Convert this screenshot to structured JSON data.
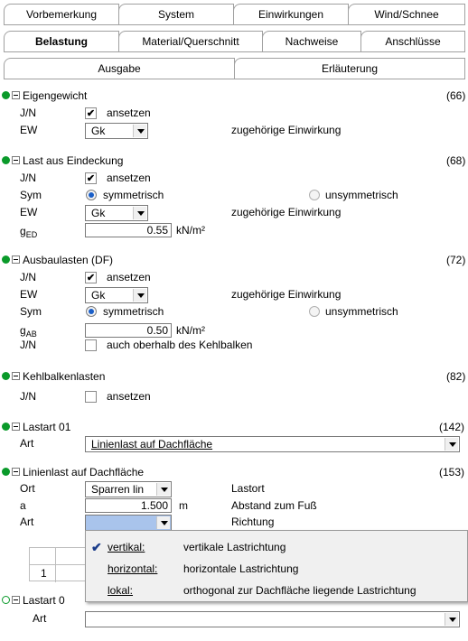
{
  "tabs": {
    "row1": [
      "Vorbemerkung",
      "System",
      "Einwirkungen",
      "Wind/Schnee"
    ],
    "row2": [
      "Belastung",
      "Material/Querschnitt",
      "Nachweise",
      "Anschlüsse"
    ],
    "row3": [
      "Ausgabe",
      "Erläuterung"
    ],
    "active": "Belastung"
  },
  "sections": {
    "eigengewicht": {
      "title": "Eigengewicht",
      "ref": "(66)",
      "jn_label": "J/N",
      "jn_text": "ansetzen",
      "ew_label": "EW",
      "ew_value": "Gk",
      "ew_hint": "zugehörige Einwirkung"
    },
    "eindeckung": {
      "title": "Last aus Eindeckung",
      "ref": "(68)",
      "jn_label": "J/N",
      "jn_text": "ansetzen",
      "sym_label": "Sym",
      "sym_opt1": "symmetrisch",
      "sym_opt2": "unsymmetrisch",
      "ew_label": "EW",
      "ew_value": "Gk",
      "ew_hint": "zugehörige Einwirkung",
      "g_label": "g",
      "g_sub": "ED",
      "g_value": "0.55",
      "g_unit": "kN/m²"
    },
    "ausbau": {
      "title": "Ausbaulasten (DF)",
      "ref": "(72)",
      "jn_label": "J/N",
      "jn_text": "ansetzen",
      "ew_label": "EW",
      "ew_value": "Gk",
      "ew_hint": "zugehörige Einwirkung",
      "sym_label": "Sym",
      "sym_opt1": "symmetrisch",
      "sym_opt2": "unsymmetrisch",
      "g_label": "g",
      "g_sub": "AB",
      "g_value": "0.50",
      "g_unit": "kN/m²",
      "jn2_label": "J/N",
      "jn2_text": "auch oberhalb des Kehlbalken"
    },
    "kehlbalken": {
      "title": "Kehlbalkenlasten",
      "ref": "(82)",
      "jn_label": "J/N",
      "jn_text": "ansetzen"
    },
    "lastart01": {
      "title": "Lastart 01",
      "ref": "(142)",
      "art_label": "Art",
      "art_value": "Linienlast auf Dachfläche"
    },
    "linienlast": {
      "title": "Linienlast auf Dachfläche",
      "ref": "(153)",
      "ort_label": "Ort",
      "ort_value": "Sparren lin",
      "ort_hint": "Lastort",
      "a_label": "a",
      "a_value": "1.500",
      "a_unit": "m",
      "a_hint": "Abstand zum Fuß",
      "art_label": "Art",
      "art_hint": "Richtung"
    },
    "lastart02": {
      "title": "Lastart 0",
      "art_label": "Art"
    }
  },
  "grid": {
    "row_label": "1"
  },
  "dropdown": {
    "items": [
      {
        "key": "vertikal:",
        "desc": "vertikale Lastrichtung",
        "checked": true
      },
      {
        "key": "horizontal:",
        "desc": "horizontale Lastrichtung",
        "checked": false
      },
      {
        "key": "lokal:",
        "desc": "orthogonal zur Dachfläche liegende Lastrichtung",
        "checked": false
      }
    ]
  },
  "colors": {
    "dot": "#0a9a2a",
    "selected_combo": "#a9c4ec",
    "radio_on": "#1a5fc8"
  },
  "icons": [
    "collapse-icon",
    "checkbox-checked-icon",
    "checkbox-empty-icon",
    "radio-on-icon",
    "radio-off-icon",
    "dropdown-arrow-icon",
    "status-dot-icon",
    "checkmark-icon"
  ]
}
